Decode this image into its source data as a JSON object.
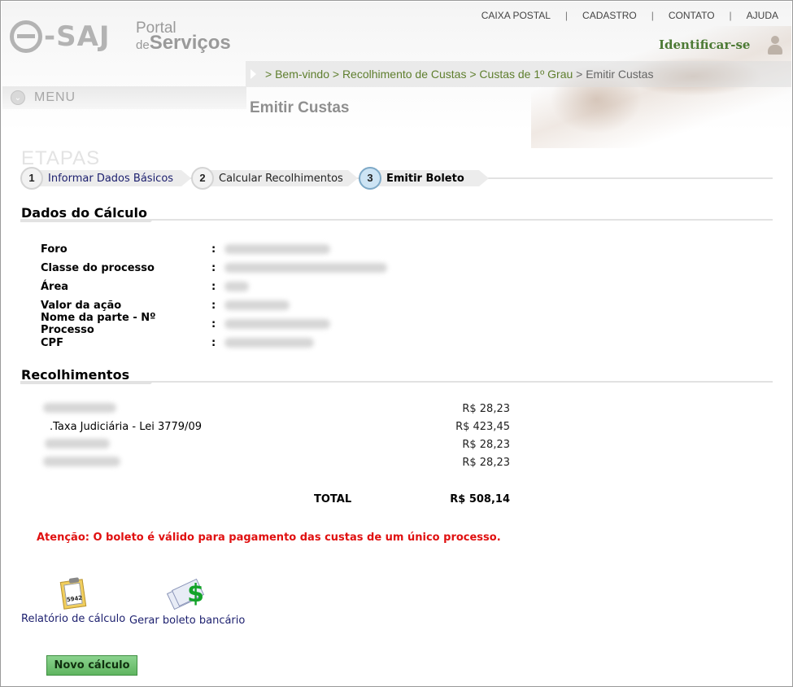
{
  "header": {
    "logo_text": "e-SAJ",
    "portal_line1": "Portal",
    "portal_line2_prefix": "de",
    "portal_line2_main": "Serviços",
    "top_nav": [
      "CAIXA POSTAL",
      "CADASTRO",
      "CONTATO",
      "AJUDA"
    ],
    "top_nav_separator": "|",
    "identificar": "Identificar-se"
  },
  "breadcrumb": {
    "items": [
      "> Bem-vindo",
      "> Recolhimento de Custas",
      "> Custas de 1º Grau"
    ],
    "current": "> Emitir Custas"
  },
  "menu": {
    "label": "MENU",
    "icon": "chevron-down-icon"
  },
  "page_title": "Emitir Custas",
  "steps": {
    "heading": "ETAPAS",
    "items": [
      {
        "number": "1",
        "label": "Informar Dados Básicos",
        "color": "#1c1f6e"
      },
      {
        "number": "2",
        "label": "Calcular Recolhimentos",
        "color": "#222222"
      },
      {
        "number": "3",
        "label": "Emitir Boleto",
        "color": "#000000"
      }
    ]
  },
  "dados_calculo": {
    "title": "Dados do Cálculo",
    "fields": [
      {
        "label": "Foro",
        "separator": ":"
      },
      {
        "label": "Classe do processo",
        "separator": ":"
      },
      {
        "label": "Área",
        "separator": ":"
      },
      {
        "label": "Valor da ação",
        "separator": ":"
      },
      {
        "label": "Nome da parte - Nº Processo",
        "separator": ":"
      },
      {
        "label": "CPF",
        "separator": ":"
      }
    ]
  },
  "recolhimentos": {
    "title": "Recolhimentos",
    "rows": [
      {
        "description": "",
        "value": "R$ 28,23"
      },
      {
        "description": ".Taxa Judiciária - Lei 3779/09",
        "value": "R$ 423,45"
      },
      {
        "description": "",
        "value": "R$ 28,23"
      },
      {
        "description": "",
        "value": "R$ 28,23"
      }
    ],
    "total_label": "TOTAL",
    "total_value": "R$ 508,14"
  },
  "warning": "Atenção: O boleto é válido para pagamento das custas de um único processo.",
  "actions": {
    "relatorio": {
      "label": "Relatório de cálculo",
      "icon_text": "5942"
    },
    "boleto": {
      "label": "Gerar boleto bancário",
      "icon_text": "$"
    }
  },
  "novo_calculo": "Novo cálculo",
  "colors": {
    "brand_green": "#4c7a34",
    "breadcrumb_green": "#5e7e2d",
    "warning_red": "#e01010",
    "link_blue": "#1c1f6e",
    "button_green": "#6ec270"
  }
}
